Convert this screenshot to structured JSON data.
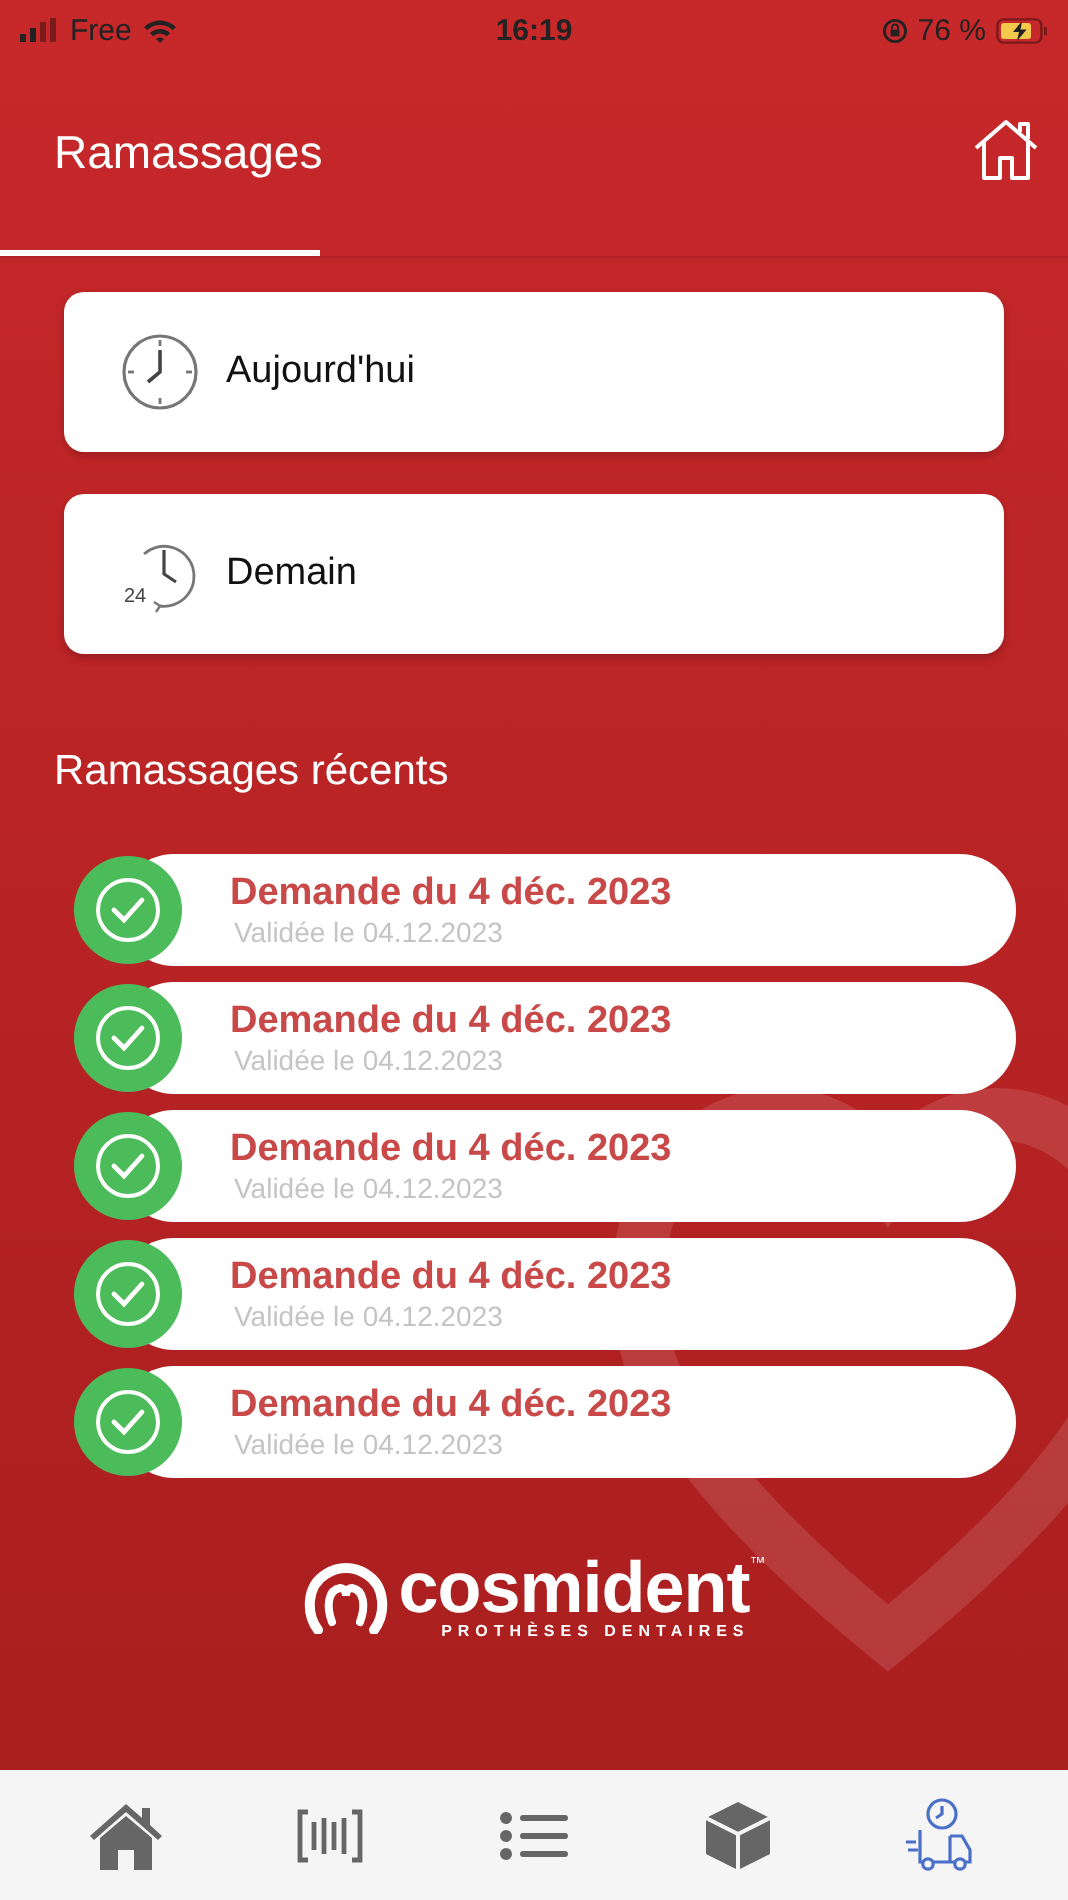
{
  "status_bar": {
    "carrier": "Free",
    "time": "16:19",
    "battery": "76 %"
  },
  "header": {
    "tabs": [
      {
        "label": "Ramassages",
        "selected": true
      }
    ]
  },
  "options": [
    {
      "kind": "today",
      "label": "Aujourd'hui"
    },
    {
      "kind": "tomorrow",
      "label": "Demain",
      "badge": "24"
    }
  ],
  "recent": {
    "title": "Ramassages récents",
    "items": [
      {
        "title": "Demande du 4 déc. 2023",
        "subtitle": "Validée le 04.12.2023",
        "validated": true
      },
      {
        "title": "Demande du 4 déc. 2023",
        "subtitle": "Validée le 04.12.2023",
        "validated": true
      },
      {
        "title": "Demande du 4 déc. 2023",
        "subtitle": "Validée le 04.12.2023",
        "validated": true
      },
      {
        "title": "Demande du 4 déc. 2023",
        "subtitle": "Validée le 04.12.2023",
        "validated": true
      },
      {
        "title": "Demande du 4 déc. 2023",
        "subtitle": "Validée le 04.12.2023",
        "validated": true
      }
    ]
  },
  "logo": {
    "name": "cosmident",
    "trademark": "™",
    "tagline": "PROTHÈSES DENTAIRES"
  },
  "tab_bar": [
    {
      "kind": "home",
      "selected": false
    },
    {
      "kind": "barcode",
      "selected": false
    },
    {
      "kind": "list",
      "selected": false
    },
    {
      "kind": "package",
      "selected": false
    },
    {
      "kind": "pickup",
      "selected": true
    }
  ]
}
